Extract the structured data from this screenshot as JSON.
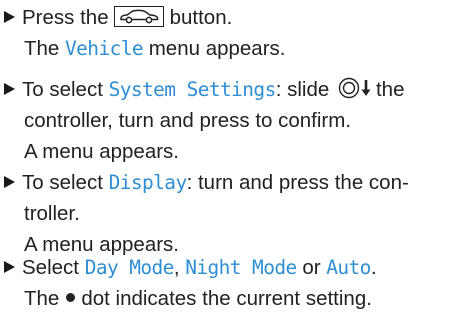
{
  "steps": [
    {
      "press_pre": "Press the",
      "press_post": "button.",
      "result": {
        "pre": "The",
        "hl": "Vehicle",
        "post": "menu appears."
      }
    },
    {
      "pre": "To select",
      "hl": "System Settings",
      "mid": ": slide",
      "post": "the",
      "line2": "controller, turn and press to confirm.",
      "result": "A menu appears."
    },
    {
      "pre": "To select",
      "hl": "Display",
      "post": ": turn and press the con-",
      "line2": "troller.",
      "result": "A menu appears."
    },
    {
      "pre": "Select",
      "hl1": "Day Mode",
      "sep": ",",
      "hl2": "Night Mode",
      "or": "or",
      "hl3": "Auto",
      "end": ".",
      "result_pre": "The",
      "result_post": "dot indicates the current setting."
    }
  ],
  "colors": {
    "highlight": "#2f8fd3",
    "text": "#222222"
  },
  "icons": [
    "vehicle-button-icon",
    "controller-slide-down-icon",
    "selection-dot-icon"
  ]
}
